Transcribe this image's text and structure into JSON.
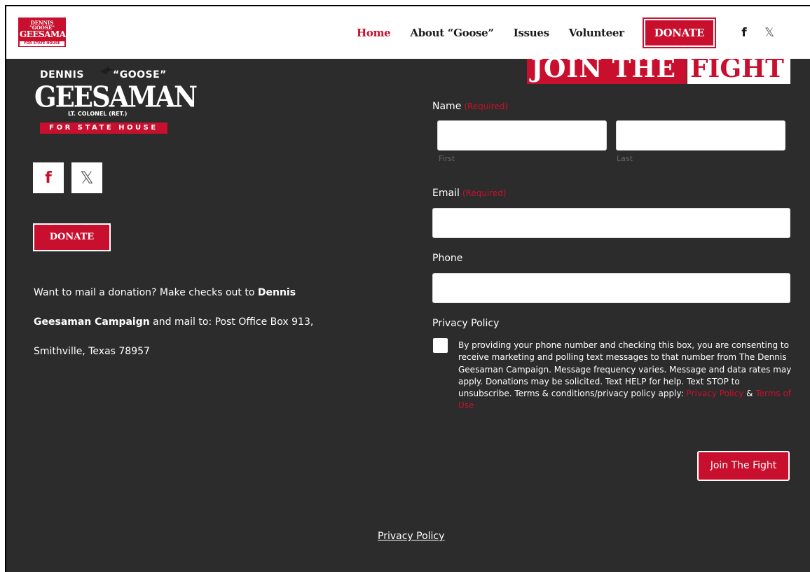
{
  "header": {
    "logo": {
      "line1": "DENNIS \"GOOSE\"",
      "line2": "GEESAMAN",
      "line3": "FOR STATE HOUSE"
    },
    "nav": [
      {
        "label": "Home",
        "active": true
      },
      {
        "label": "About “Goose”"
      },
      {
        "label": "Issues"
      },
      {
        "label": "Volunteer"
      }
    ],
    "donate_label": "DONATE",
    "social": {
      "facebook": "f",
      "x": "𝕏"
    }
  },
  "left": {
    "logo": {
      "first": "DENNIS",
      "nick": "“GOOSE”",
      "surname": "GEESAMAN",
      "rank": "LT. COLONEL (RET.)",
      "office": "FOR STATE HOUSE"
    },
    "social": {
      "facebook": "f",
      "x": "𝕏"
    },
    "donate_label": "DONATE",
    "mail": {
      "pre": "Want to mail a donation? Make checks out to ",
      "bold": "Dennis Geesaman Campaign",
      "post": " and mail to: Post Office Box 913, Smithville, Texas 78957"
    }
  },
  "form": {
    "banner": {
      "red": "JOIN THE",
      "white": "FIGHT"
    },
    "name_label": "Name",
    "required_tag": "(Required)",
    "first_sub": "First",
    "last_sub": "Last",
    "email_label": "Email",
    "phone_label": "Phone",
    "privacy_label": "Privacy Policy",
    "consent_text": "By providing your phone number and checking this box, you are consenting to receive marketing and polling text messages to that number from The Dennis Geesaman Campaign. Message frequency varies. Message and data rates may apply. Donations may be solicited. Text HELP for help. Text STOP to unsubscribe. Terms & conditions/privacy policy apply: ",
    "consent_link1": "Privacy Policy",
    "consent_amp": " & ",
    "consent_link2": "Terms of Use",
    "submit_label": "Join The Fight"
  },
  "footer": {
    "privacy": "Privacy Policy"
  },
  "colors": {
    "brand_red": "#c8102e",
    "background": "#2c2c2c"
  }
}
